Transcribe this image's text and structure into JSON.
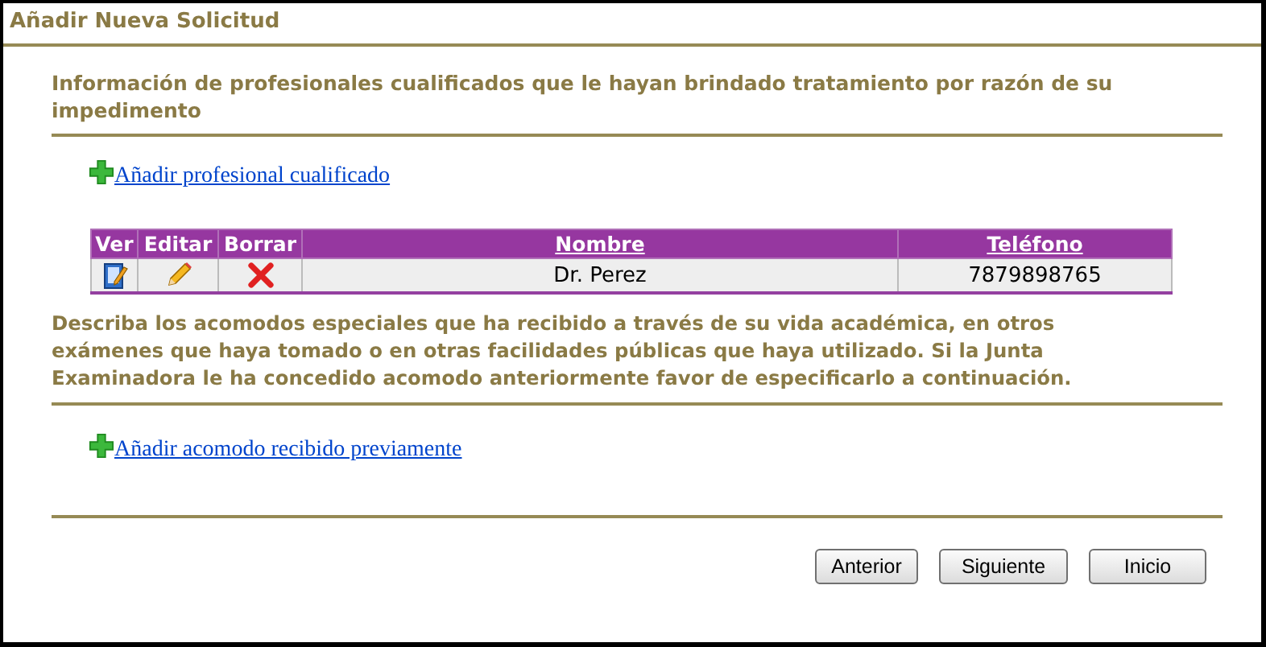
{
  "window": {
    "title": "Añadir Nueva Solicitud"
  },
  "sections": [
    {
      "heading": "Información de profesionales cualificados que le hayan brindado tratamiento por razón de su impedimento",
      "link": "Añadir profesional cualificado",
      "table": {
        "columns": [
          {
            "label": "Ver",
            "sortable": false
          },
          {
            "label": "Editar",
            "sortable": false
          },
          {
            "label": "Borrar",
            "sortable": false
          },
          {
            "label": "Nombre",
            "sortable": true
          },
          {
            "label": "Teléfono",
            "sortable": true
          }
        ],
        "rows": [
          {
            "name": "Dr. Perez",
            "phone": "7879898765"
          }
        ]
      }
    },
    {
      "heading": "Describa los acomodos especiales que ha recibido a través de su vida académica, en otros exámenes que haya tomado o en otras facilidades públicas que haya utilizado. Si la Junta Examinadora le ha concedido acomodo anteriormente favor de especificarlo a continuación.",
      "link": "Añadir acomodo recibido previamente"
    }
  ],
  "buttons": [
    "Anterior",
    "Siguiente",
    "Inicio"
  ]
}
